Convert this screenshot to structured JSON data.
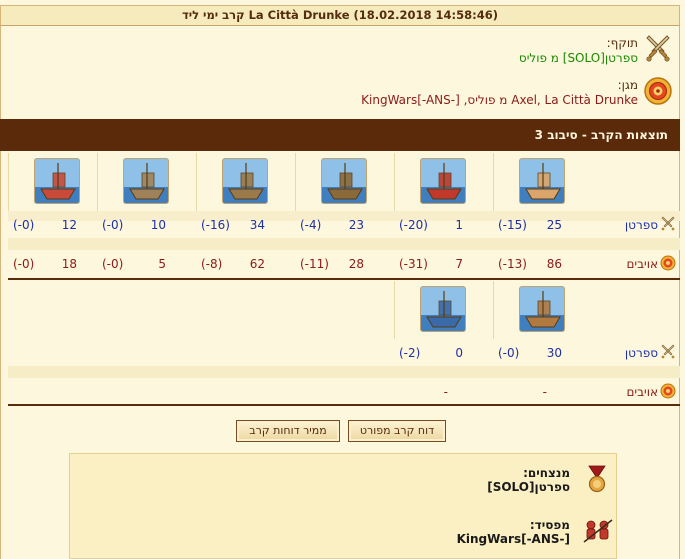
{
  "title": "קרב ימי ליד La Città Drunke (18.02.2018 14:58:46)",
  "attacker": {
    "label": "תוקף:",
    "value": "ספרטן[SOLO] מ פוליס",
    "icon": "crossed-swords-icon"
  },
  "defender": {
    "label": "מגן:",
    "value": "Axel, La Città Drunke מ פוליס, [-KingWars[-ANS",
    "icon": "shield-target-icon"
  },
  "section_title": "תוצאות הקרב - סיבוב 3",
  "round1": {
    "units": [
      {
        "name": "ship-icon",
        "color": "#d9a56a"
      },
      {
        "name": "fire-ship-icon",
        "color": "#c0392b"
      },
      {
        "name": "catapult-ship-icon",
        "color": "#8a6a3a"
      },
      {
        "name": "ballista-ship-icon",
        "color": "#9a7a4a"
      },
      {
        "name": "mortar-ship-icon",
        "color": "#a0825a"
      },
      {
        "name": "rocket-ship-icon",
        "color": "#c94a3a"
      }
    ],
    "attacker_label": "ספרטן",
    "defender_label": "אויבים",
    "attacker": [
      {
        "count": "25",
        "loss": "(-15)"
      },
      {
        "count": "1",
        "loss": "(-20)"
      },
      {
        "count": "23",
        "loss": "(-4)"
      },
      {
        "count": "34",
        "loss": "(-16)"
      },
      {
        "count": "10",
        "loss": "(-0)"
      },
      {
        "count": "12",
        "loss": "(-0)"
      }
    ],
    "defender": [
      {
        "count": "86",
        "loss": "(-13)"
      },
      {
        "count": "7",
        "loss": "(-31)"
      },
      {
        "count": "28",
        "loss": "(-11)"
      },
      {
        "count": "62",
        "loss": "(-8)"
      },
      {
        "count": "5",
        "loss": "(-0)"
      },
      {
        "count": "18",
        "loss": "(-0)"
      }
    ]
  },
  "round2": {
    "units": [
      {
        "name": "diving-boat-icon",
        "color": "#b07a40"
      },
      {
        "name": "paddle-steamer-icon",
        "color": "#3a6aa8"
      }
    ],
    "attacker_label": "ספרטן",
    "defender_label": "אויבים",
    "attacker": [
      {
        "count": "30",
        "loss": "(-0)"
      },
      {
        "count": "0",
        "loss": "(-2)"
      }
    ],
    "defender": [
      {
        "dash": "-"
      },
      {
        "dash": "-"
      }
    ]
  },
  "buttons": {
    "detailed_report": "דוח קרב מפורט",
    "convert_reports": "ממיר דוחות קרב"
  },
  "result": {
    "winners_label": "מנצחים:",
    "winners_value": "ספרטן[SOLO]",
    "loser_label": "מפסיד:",
    "loser_value": "[-KingWars[-ANS"
  }
}
